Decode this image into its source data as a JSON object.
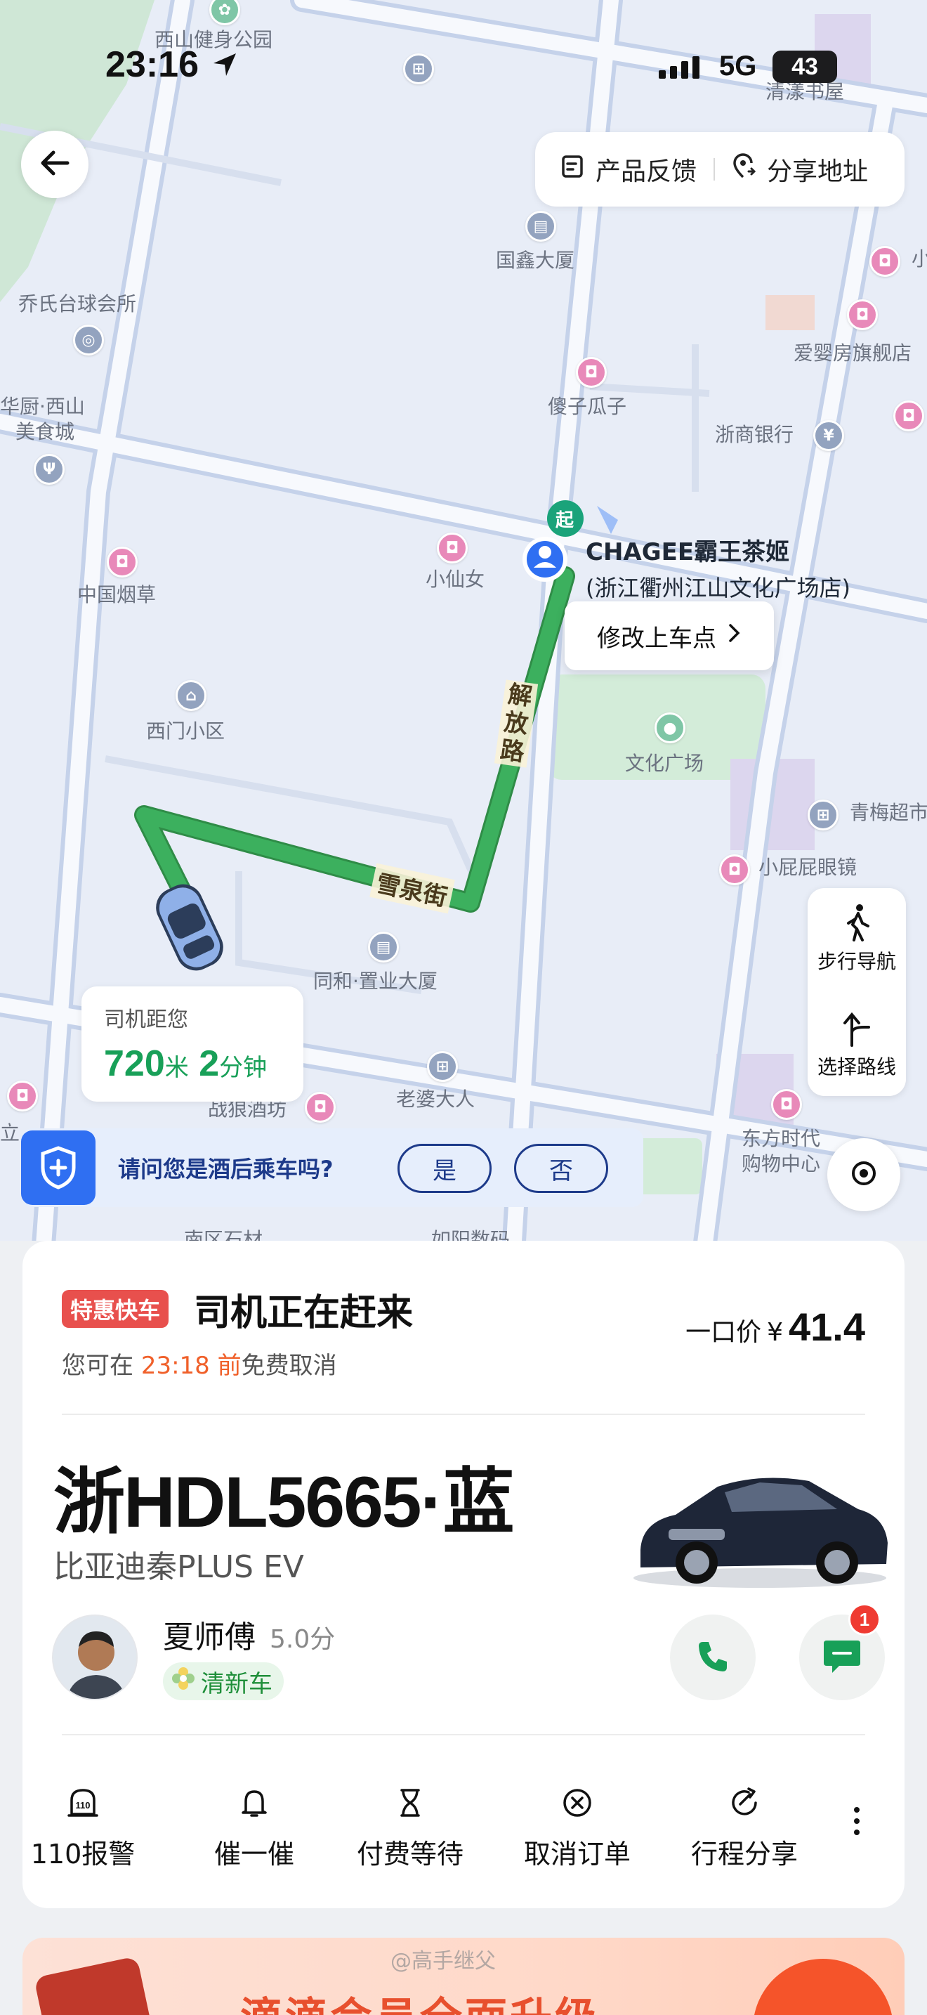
{
  "status_bar": {
    "time": "23:16",
    "network": "5G",
    "battery": "43"
  },
  "header": {
    "feedback_label": "产品反馈",
    "share_label": "分享地址"
  },
  "map": {
    "labels": {
      "park": "西山健身公园",
      "bookstore": "清漾书屋",
      "guoxin": "国鑫大厦",
      "qiaoshi": "乔氏台球会所",
      "muying": "爱婴房旗舰店",
      "huachu": "华厨·西山",
      "meishicheng": "美食城",
      "shazi": "傻子瓜子",
      "zheshang": "浙商银行",
      "yancao": "中国烟草",
      "xiaoxiannv": "小仙女",
      "ximen": "西门小区",
      "wenhua": "文化广场",
      "qingmei": "青梅超市",
      "xiaopipi": "小屁屁眼镜",
      "tonghe": "同和·置业大厦",
      "laopo": "老婆大人",
      "zhanshen": "战狼酒坊",
      "dongfang1": "东方时代",
      "dongfang2": "购物中心",
      "li": "立",
      "xiao_edge": "小",
      "bottom1": "南区石材",
      "bottom2": "如阳数码"
    },
    "road_jiefang": "解放路",
    "road_xuequan": "雪泉街",
    "start_marker": "起",
    "pickup_name": "CHAGEE霸王茶姬",
    "pickup_sub": "(浙江衢州江山文化广场店)",
    "modify_label": "修改上车点",
    "walk_nav_label": "步行导航",
    "route_select_label": "选择路线",
    "eta": {
      "label": "司机距您",
      "distance": "720",
      "distance_unit": "米",
      "minutes": "2",
      "minutes_unit": "分钟"
    },
    "drunk_question": "请问您是酒后乘车吗?",
    "yes_label": "是",
    "no_label": "否"
  },
  "order": {
    "tag": "特惠快车",
    "status": "司机正在赶来",
    "cancel_prefix": "您可在",
    "cancel_time": "23:18",
    "cancel_before": "前",
    "cancel_suffix": "免费取消",
    "price_label": "一口价",
    "price_currency": "¥",
    "price_value": "41.4",
    "plate": "浙HDL5665·蓝",
    "car_model": "比亚迪秦PLUS EV",
    "driver_name": "夏师傅",
    "driver_score": "5.0分",
    "clean_badge": "清新车",
    "message_count": "1",
    "actions": [
      {
        "icon": "police-110-icon",
        "label": "110报警"
      },
      {
        "icon": "bell-icon",
        "label": "催一催"
      },
      {
        "icon": "hourglass-icon",
        "label": "付费等待"
      },
      {
        "icon": "cancel-circle-icon",
        "label": "取消订单"
      },
      {
        "icon": "share-arrow-icon",
        "label": "行程分享"
      }
    ]
  },
  "promo": {
    "text": "滴滴会员全面升级",
    "watermark": "@高手继父"
  },
  "colors": {
    "route": "#3cb05e",
    "accent_green": "#18a058",
    "tag_red": "#e8504d",
    "highlight_orange": "#f0602a",
    "safety_blue": "#2f6ff2"
  }
}
